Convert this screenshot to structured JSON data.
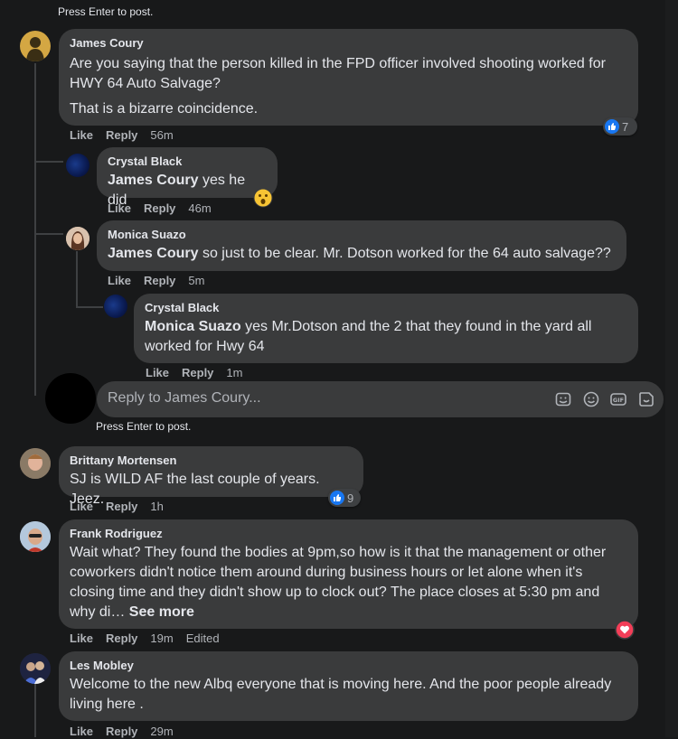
{
  "top_hint": "Press Enter to post.",
  "comments": [
    {
      "author": "James Coury",
      "para1": "Are you saying that the person killed in the FPD officer involved shooting worked for HWY 64 Auto Salvage?",
      "para2": "That is a bizarre coincidence.",
      "like": "Like",
      "reply": "Reply",
      "time": "56m",
      "reaction_count": "7"
    },
    {
      "author": "Crystal Black",
      "mention": "James Coury",
      "text": " yes he did",
      "like": "Like",
      "reply": "Reply",
      "time": "46m"
    },
    {
      "author": "Monica Suazo",
      "mention": "James Coury",
      "text": " so just to be clear. Mr. Dotson worked for the 64 auto salvage??",
      "like": "Like",
      "reply": "Reply",
      "time": "5m"
    },
    {
      "author": "Crystal Black",
      "mention": "Monica Suazo",
      "text": " yes Mr.Dotson and the 2 that they found in the yard all worked for Hwy 64",
      "like": "Like",
      "reply": "Reply",
      "time": "1m"
    },
    {
      "author": "Brittany Mortensen",
      "text": "SJ is WILD AF the last couple of years. Jeez.",
      "like": "Like",
      "reply": "Reply",
      "time": "1h",
      "reaction_count": "9"
    },
    {
      "author": "Frank Rodriguez",
      "text": "Wait what? They found the bodies at 9pm,so how is it that the management or other coworkers didn't notice them around during business hours or let alone when it's closing time and they didn't show up to clock out? The place closes at 5:30 pm and why di… ",
      "see_more": "See more",
      "like": "Like",
      "reply": "Reply",
      "time": "19m",
      "edited": "Edited"
    },
    {
      "author": "Les Mobley",
      "text": "Welcome to the new Albq everyone that is moving here. And the poor people already living here .",
      "like": "Like",
      "reply": "Reply",
      "time": "29m"
    }
  ],
  "reply_box": {
    "placeholder": "Reply to James Coury...",
    "hint": "Press Enter to post.",
    "icons": [
      "sticker-icon",
      "emoji-icon",
      "gif-icon",
      "sticker-alt-icon"
    ]
  },
  "colors": {
    "background": "#18191a",
    "bubble": "#3a3b3c",
    "text": "#e4e6eb",
    "secondary_text": "#b0b3b8",
    "like_blue": "#1877f2",
    "love_red": "#f33e58"
  }
}
